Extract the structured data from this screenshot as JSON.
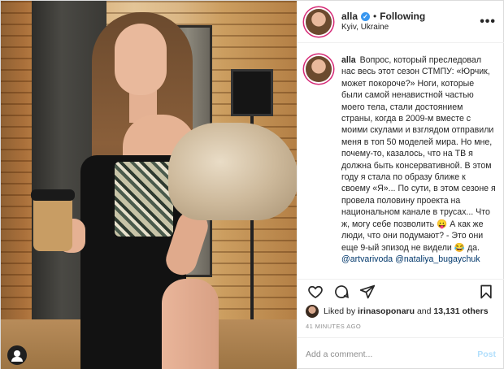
{
  "post": {
    "username": "alla",
    "verified_mark": "✓",
    "dot": "•",
    "following_label": "Following",
    "location": "Kyiv, Ukraine",
    "more_icon": "•••"
  },
  "caption": {
    "username": "alla",
    "text_1": "Вопрос, который преследовал нас весь этот сезон СТМПУ: «Юрчик, может покороче?» Ноги, которые были самой ненавистной частью моего тела, стали достоянием страны, когда в 2009-м вместе с моими скулами и взглядом отправили меня в топ 50 моделей мира. Но мне, почему-то, казалось, что на ТВ я должна быть консервативной. В этом году я стала по образу ближе к своему «Я»... По сути, в этом сезоне я провела половину проекта на национальном канале в трусах... Что ж, могу себе позволить ",
    "emoji_1": "😛",
    "text_2": " А как же люди, что они подумают? - Это они еще 9-ый эпизод не видели ",
    "emoji_2": "😂",
    "text_3": " да.",
    "mention_1": "@artvarivoda",
    "mention_2": "@nataliya_bugaychuk"
  },
  "likes": {
    "prefix": "Liked by ",
    "user": "irinasoponaru",
    "and": " and ",
    "count": "13,131 others"
  },
  "timestamp": "41 MINUTES AGO",
  "comment_box": {
    "placeholder": "Add a comment...",
    "post_label": "Post"
  },
  "icons": {
    "like": "heart-icon",
    "comment": "comment-icon",
    "share": "share-icon",
    "save": "bookmark-icon",
    "tag": "user-tag-icon"
  },
  "colors": {
    "link": "#00376b",
    "verified": "#3897f0",
    "post_disabled": "#b2dffc",
    "muted": "#8e8e8e"
  }
}
